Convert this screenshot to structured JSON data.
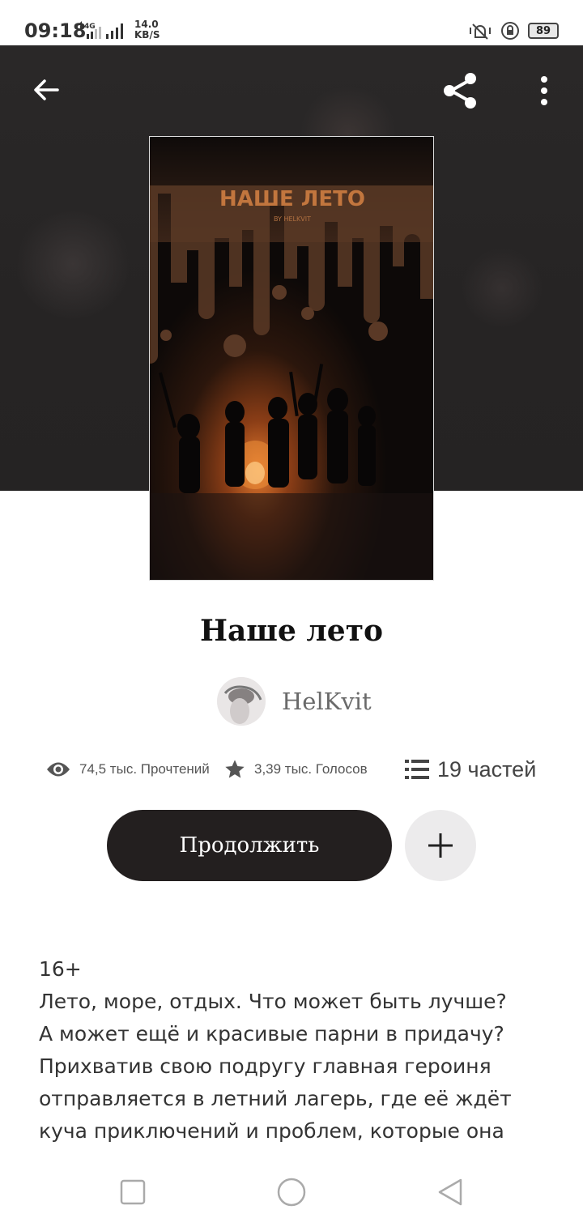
{
  "status_bar": {
    "time": "09:18",
    "network": "4G",
    "speed_value": "14.0",
    "speed_unit": "KB/S",
    "battery": "89"
  },
  "header": {
    "back_icon": "arrow-left-icon",
    "share_icon": "share-icon",
    "more_icon": "more-vertical-icon"
  },
  "book": {
    "cover_title": "НАШЕ ЛЕТО",
    "cover_byline": "BY HELKVIT",
    "title": "Наше лето",
    "author": "HelKvit",
    "stats": {
      "reads": "74,5 тыс. Прочтений",
      "votes": "3,39 тыс. Голосов",
      "parts": "19 частей"
    },
    "continue_label": "Продолжить",
    "add_icon": "plus-icon",
    "description": [
      "16+",
      "Лето, море, отдых. Что может быть лучше?",
      "А может ещё и красивые парни в придачу?",
      "Прихватив свою подругу главная героиня",
      "отправляется в летний лагерь, где её ждёт",
      "куча приключений и проблем, которые она"
    ]
  },
  "nav_bar": {
    "recents_icon": "square-icon",
    "home_icon": "circle-icon",
    "back_icon": "triangle-back-icon"
  }
}
